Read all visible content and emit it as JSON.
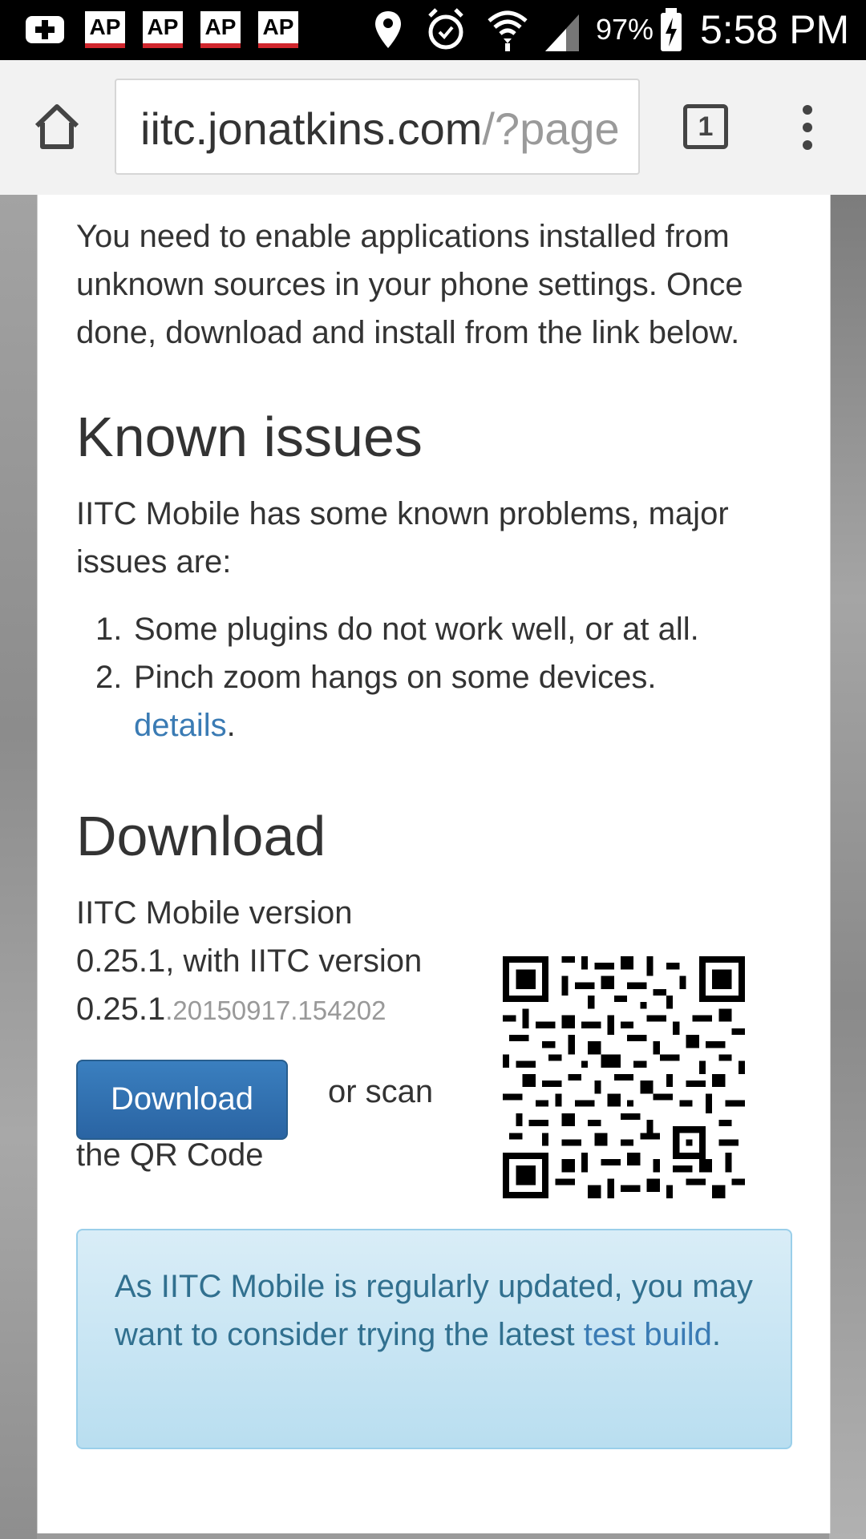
{
  "status_bar": {
    "notifications": [
      "AP",
      "AP",
      "AP",
      "AP"
    ],
    "battery": "97%",
    "time": "5:58 PM"
  },
  "browser": {
    "url_host": "iitc.jonatkins.com",
    "url_rest": "/?page",
    "tab_count": "1"
  },
  "content": {
    "intro": "You need to enable applications installed from unknown sources in your phone settings. Once done, download and install from the link below.",
    "known_issues_heading": "Known issues",
    "known_issues_intro": "IITC Mobile has some known problems, major issues are:",
    "issues": [
      {
        "num": "1.",
        "text": "Some plugins do not work well, or at all."
      },
      {
        "num": "2.",
        "text": "Pinch zoom hangs on some devices.",
        "link": "details",
        "suffix": "."
      }
    ],
    "download_heading": "Download",
    "version_line1": "IITC Mobile version",
    "version_line2": "0.25.1, with IITC version",
    "version_main": "0.25.1",
    "version_build": ".20150917.154202",
    "download_button": "Download",
    "or_scan": "or scan",
    "qr_caption": "the QR Code",
    "alert_text": "As IITC Mobile is regularly updated, you may want to consider trying the latest ",
    "alert_link": "test build",
    "alert_suffix": "."
  }
}
